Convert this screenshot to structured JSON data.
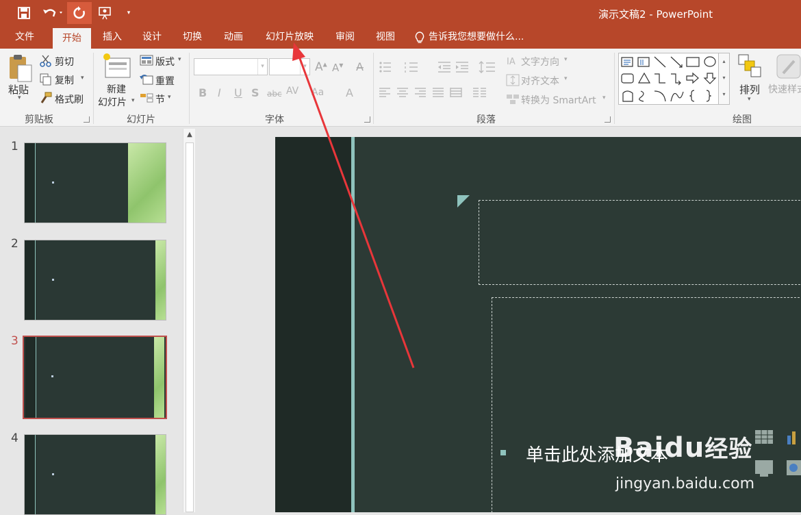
{
  "window": {
    "title": "演示文稿2 - PowerPoint"
  },
  "tabs": [
    {
      "label": "文件"
    },
    {
      "label": "开始"
    },
    {
      "label": "插入"
    },
    {
      "label": "设计"
    },
    {
      "label": "切换"
    },
    {
      "label": "动画"
    },
    {
      "label": "幻灯片放映"
    },
    {
      "label": "审阅"
    },
    {
      "label": "视图"
    }
  ],
  "active_tab": "开始",
  "tell_me": "告诉我您想要做什么...",
  "ribbon": {
    "clipboard": {
      "paste": "粘贴",
      "cut": "剪切",
      "copy": "复制",
      "format_painter": "格式刷",
      "label": "剪贴板"
    },
    "slides": {
      "new_slide_1": "新建",
      "new_slide_2": "幻灯片",
      "layout": "版式",
      "reset": "重置",
      "section": "节",
      "label": "幻灯片"
    },
    "font": {
      "label": "字体",
      "font_name": "",
      "font_size": ""
    },
    "paragraph": {
      "text_direction": "文字方向",
      "align_text": "对齐文本",
      "smartart": "转换为 SmartArt",
      "label": "段落"
    },
    "drawing": {
      "arrange": "排列",
      "quick_styles": "快速样式",
      "label": "绘图"
    }
  },
  "slides": [
    {
      "number": "1"
    },
    {
      "number": "2"
    },
    {
      "number": "3"
    },
    {
      "number": "4"
    }
  ],
  "selected_slide": "3",
  "slide": {
    "body_placeholder": "单击此处添加文本"
  },
  "watermark": {
    "brand": "Baidu",
    "cn": "经验",
    "url": "jingyan.baidu.com"
  },
  "colors": {
    "accent": "#b7472a",
    "slide_bg": "#2c3a35",
    "theme_accent": "#8fc3bd",
    "annotation": "#e8363a"
  }
}
